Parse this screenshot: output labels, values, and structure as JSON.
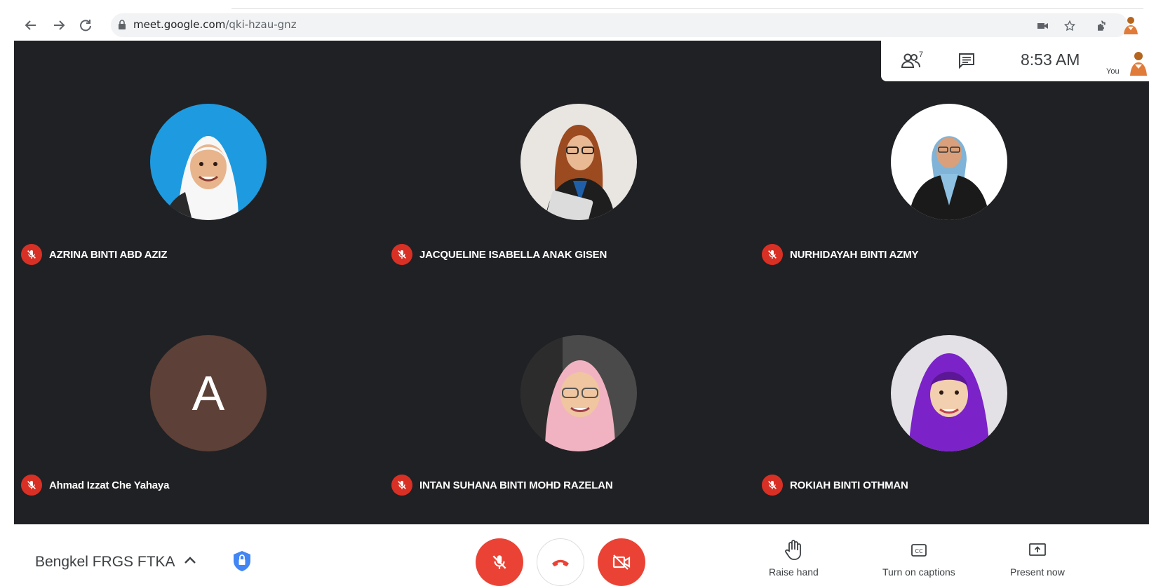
{
  "browser": {
    "url_domain": "meet.google.com",
    "url_path": "/qki-hzau-gnz",
    "icons": [
      "back-arrow-icon",
      "forward-arrow-icon",
      "reload-icon",
      "lock-icon",
      "camera-icon",
      "star-icon",
      "extensions-icon",
      "profile-icon"
    ]
  },
  "info_panel": {
    "participant_count": "7",
    "time": "8:53 AM",
    "you_label": "You"
  },
  "participants": [
    {
      "name": "AZRINA BINTI ABD AZIZ",
      "muted": true
    },
    {
      "name": "JACQUELINE ISABELLA ANAK GISEN",
      "muted": true
    },
    {
      "name": "NURHIDAYAH BINTI AZMY",
      "muted": true
    },
    {
      "name": "Ahmad Izzat Che Yahaya",
      "muted": true,
      "initial": "A"
    },
    {
      "name": "INTAN SUHANA BINTI MOHD RAZELAN",
      "muted": true
    },
    {
      "name": "ROKIAH BINTI OTHMAN",
      "muted": true
    }
  ],
  "bottom_bar": {
    "meeting_title": "Bengkel FRGS FTKA",
    "raise_hand": "Raise hand",
    "captions": "Turn on captions",
    "present": "Present now"
  },
  "colors": {
    "stage_bg": "#202124",
    "mute_red": "#d93025",
    "control_red": "#ea4335",
    "initial_avatar_bg": "#5d4037"
  }
}
